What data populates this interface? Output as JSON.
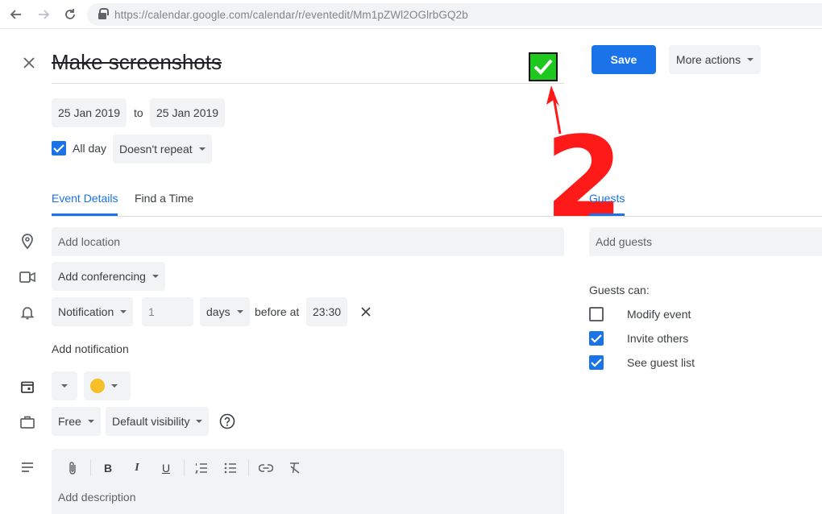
{
  "browser": {
    "url": "https://calendar.google.com/calendar/r/eventedit/Mm1pZWl2OGlrbGQ2b"
  },
  "event": {
    "title": "Make screenshots",
    "start_date": "25 Jan 2019",
    "to_label": "to",
    "end_date": "25 Jan 2019",
    "all_day_label": "All day",
    "all_day_checked": true,
    "repeat": "Doesn't repeat"
  },
  "header": {
    "save_label": "Save",
    "more_actions_label": "More actions"
  },
  "tabs": {
    "event_details": "Event Details",
    "find_time": "Find a Time",
    "guests": "Guests"
  },
  "details": {
    "location_placeholder": "Add location",
    "conferencing": "Add conferencing",
    "notification_type": "Notification",
    "notification_amount": "1",
    "notification_unit": "days",
    "before_at": "before at",
    "notification_time": "23:30",
    "add_notification": "Add notification",
    "calendar_color": "#f6bf26",
    "availability": "Free",
    "visibility": "Default visibility",
    "description_placeholder": "Add description"
  },
  "guests": {
    "add_placeholder": "Add guests",
    "can_label": "Guests can:",
    "permissions": [
      {
        "label": "Modify event",
        "checked": false
      },
      {
        "label": "Invite others",
        "checked": true
      },
      {
        "label": "See guest list",
        "checked": true
      }
    ]
  },
  "annotation": {
    "number": "2",
    "color": "#ff1a1a"
  },
  "colors": {
    "accent": "#1a73e8",
    "field_bg": "#f1f3f4",
    "check_green": "#1ec81e"
  }
}
